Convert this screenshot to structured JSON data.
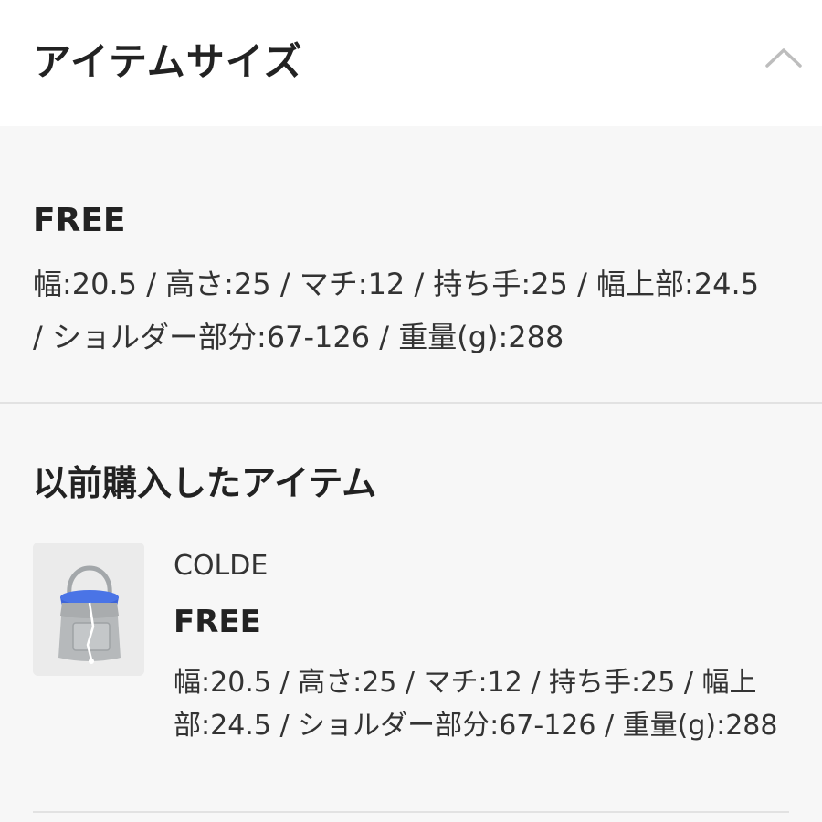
{
  "header": {
    "title": "アイテムサイズ",
    "collapse_icon": "chevron-up-icon"
  },
  "size": {
    "label": "FREE",
    "description": "幅:20.5 / 高さ:25 / マチ:12 / 持ち手:25 / 幅上部:24.5 / ショルダー部分:67-126 / 重量(g):288"
  },
  "previous": {
    "title": "以前購入したアイテム",
    "items": [
      {
        "thumbnail": "bag-thumbnail",
        "brand": "COLDE",
        "size": "FREE",
        "description": "幅:20.5 / 高さ:25 / マチ:12 / 持ち手:25 / 幅上部:24.5 / ショルダー部分:67-126 / 重量(g):288"
      }
    ]
  },
  "colors": {
    "background": "#f7f7f7",
    "header_background": "#ffffff",
    "text": "#222222",
    "divider": "#e2e2e2",
    "chevron": "#bdbdbd"
  }
}
